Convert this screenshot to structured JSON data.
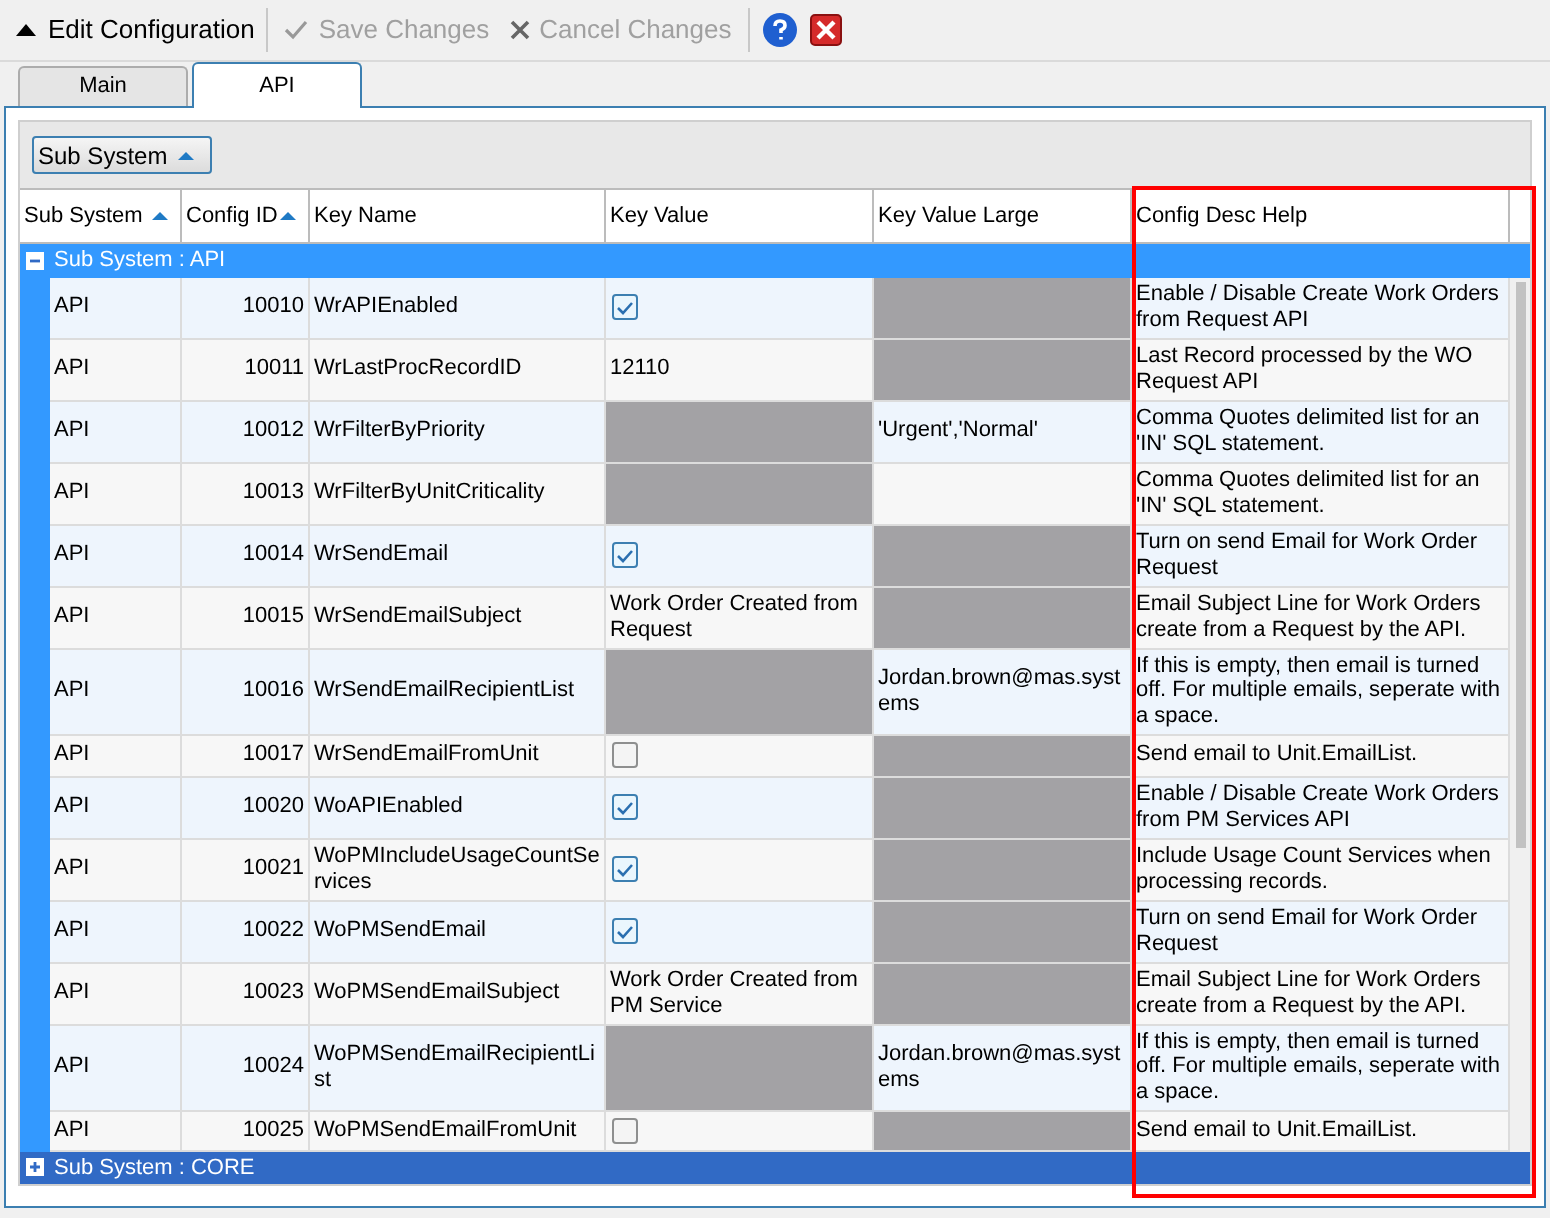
{
  "toolbar": {
    "title": "Edit Configuration",
    "buttons": [
      {
        "label": "Save Changes",
        "kind": "save",
        "disabled": true
      },
      {
        "label": "Cancel Changes",
        "kind": "cancel",
        "disabled": true
      }
    ]
  },
  "tabs": [
    {
      "label": "Main",
      "selected": false
    },
    {
      "label": "API",
      "selected": true
    }
  ],
  "group_by": {
    "label": "Sub System"
  },
  "table": {
    "columns": [
      {
        "label": "Sub System",
        "sorted": true
      },
      {
        "label": "Config ID",
        "sorted": true
      },
      {
        "label": "Key Name",
        "sorted": false
      },
      {
        "label": "Key Value",
        "sorted": false
      },
      {
        "label": "Key Value Large",
        "sorted": false
      },
      {
        "label": "Config Desc Help",
        "sorted": false
      }
    ],
    "groups": [
      {
        "label": "Sub System : API",
        "expanded": true,
        "rows": [
          {
            "sub_system": "API",
            "config_id": "10010",
            "key_name": "WrAPIEnabled",
            "key_value": {
              "kind": "checkbox",
              "checked": true
            },
            "key_value_large": {
              "kind": "disabled"
            },
            "desc": "Enable / Disable Create Work Orders from Request API"
          },
          {
            "sub_system": "API",
            "config_id": "10011",
            "key_name": "WrLastProcRecordID",
            "key_value": {
              "kind": "text",
              "text": "12110"
            },
            "key_value_large": {
              "kind": "disabled"
            },
            "desc": "Last Record processed by the WO Request API"
          },
          {
            "sub_system": "API",
            "config_id": "10012",
            "key_name": "WrFilterByPriority",
            "key_value": {
              "kind": "disabled"
            },
            "key_value_large": {
              "kind": "text",
              "text": "'Urgent','Normal'"
            },
            "desc": "Comma Quotes delimited list for an 'IN' SQL statement."
          },
          {
            "sub_system": "API",
            "config_id": "10013",
            "key_name": "WrFilterByUnitCriticality",
            "key_value": {
              "kind": "disabled"
            },
            "key_value_large": {
              "kind": "empty"
            },
            "desc": "Comma Quotes delimited list for an 'IN' SQL statement."
          },
          {
            "sub_system": "API",
            "config_id": "10014",
            "key_name": "WrSendEmail",
            "key_value": {
              "kind": "checkbox",
              "checked": true
            },
            "key_value_large": {
              "kind": "disabled"
            },
            "desc": "Turn on send Email for Work Order Request"
          },
          {
            "sub_system": "API",
            "config_id": "10015",
            "key_name": "WrSendEmailSubject",
            "key_value": {
              "kind": "text",
              "text": "Work Order Created from Request"
            },
            "key_value_large": {
              "kind": "disabled"
            },
            "desc": "Email Subject Line for Work Orders create from a Request by the API."
          },
          {
            "sub_system": "API",
            "config_id": "10016",
            "key_name": "WrSendEmailRecipientList",
            "key_value": {
              "kind": "disabled"
            },
            "key_value_large": {
              "kind": "text",
              "text": "Jordan.brown@mas.systems"
            },
            "desc": "If this is empty, then email is turned off. For multiple emails, seperate with a space."
          },
          {
            "sub_system": "API",
            "config_id": "10017",
            "key_name": "WrSendEmailFromUnit",
            "key_value": {
              "kind": "checkbox",
              "checked": false
            },
            "key_value_large": {
              "kind": "disabled"
            },
            "desc": "Send email to Unit.EmailList."
          },
          {
            "sub_system": "API",
            "config_id": "10020",
            "key_name": "WoAPIEnabled",
            "key_value": {
              "kind": "checkbox",
              "checked": true
            },
            "key_value_large": {
              "kind": "disabled"
            },
            "desc": "Enable / Disable Create Work Orders from PM Services API"
          },
          {
            "sub_system": "API",
            "config_id": "10021",
            "key_name": "WoPMIncludeUsageCountServices",
            "key_value": {
              "kind": "checkbox",
              "checked": true
            },
            "key_value_large": {
              "kind": "disabled"
            },
            "desc": "Include Usage Count Services when processing records."
          },
          {
            "sub_system": "API",
            "config_id": "10022",
            "key_name": "WoPMSendEmail",
            "key_value": {
              "kind": "checkbox",
              "checked": true
            },
            "key_value_large": {
              "kind": "disabled"
            },
            "desc": "Turn on send Email for Work Order Request"
          },
          {
            "sub_system": "API",
            "config_id": "10023",
            "key_name": "WoPMSendEmailSubject",
            "key_value": {
              "kind": "text",
              "text": "Work Order Created from PM Service"
            },
            "key_value_large": {
              "kind": "disabled"
            },
            "desc": "Email Subject Line for Work Orders create from a Request by the API."
          },
          {
            "sub_system": "API",
            "config_id": "10024",
            "key_name": "WoPMSendEmailRecipientList",
            "key_value": {
              "kind": "disabled"
            },
            "key_value_large": {
              "kind": "text",
              "text": "Jordan.brown@mas.systems"
            },
            "desc": "If this is empty, then email is turned off. For multiple emails, seperate with a space."
          },
          {
            "sub_system": "API",
            "config_id": "10025",
            "key_name": "WoPMSendEmailFromUnit",
            "key_value": {
              "kind": "checkbox",
              "checked": false
            },
            "key_value_large": {
              "kind": "disabled"
            },
            "desc": "Send email to Unit.EmailList."
          }
        ]
      },
      {
        "label": "Sub System : CORE",
        "expanded": false
      }
    ]
  }
}
